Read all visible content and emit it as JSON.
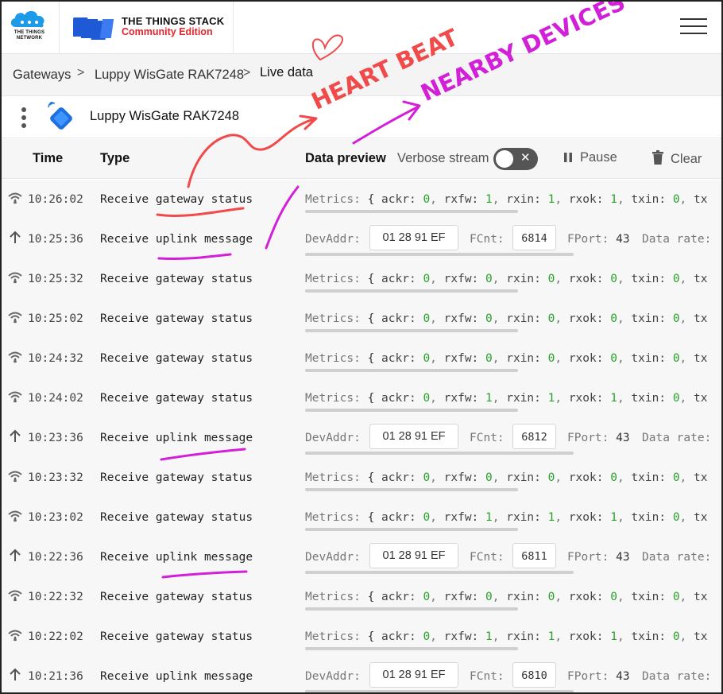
{
  "header": {
    "network_logo_text": "THE THINGS NETWORK",
    "product_title": "THE THINGS STACK",
    "product_subtitle": "Community Edition",
    "colors": {
      "accent_red": "#e3262c",
      "logo_blue": "#1e5ad6",
      "cloud_blue": "#1d9be8"
    },
    "menu_icon": "hamburger-menu-icon"
  },
  "breadcrumb": {
    "items": [
      "Gateways",
      "Luppy WisGate RAK7248",
      "Live data"
    ],
    "separator": ">"
  },
  "gateway": {
    "name": "Luppy WisGate RAK7248",
    "icon": "gateway-icon",
    "menu_icon": "kebab-menu-icon"
  },
  "table": {
    "columns": {
      "time": "Time",
      "type": "Type",
      "preview": "Data preview"
    },
    "verbose_label": "Verbose stream",
    "verbose_enabled": false,
    "pause_label": "Pause",
    "clear_label": "Clear"
  },
  "metrics_labels": {
    "prefix": "Metrics:",
    "ackr": "ackr:",
    "rxfw": "rxfw:",
    "rxin": "rxin:",
    "rxok": "rxok:",
    "txin": "txin:",
    "tx": "tx"
  },
  "uplink_labels": {
    "devaddr": "DevAddr:",
    "fcnt": "FCnt:",
    "fport": "FPort:",
    "datarate": "Data rate:"
  },
  "events": [
    {
      "dir": "gateway-status-icon",
      "time": "10:26:02",
      "type": "Receive gateway status",
      "kind": "status",
      "ackr": "0",
      "rxfw": "1",
      "rxin": "1",
      "rxok": "1",
      "txin": "0"
    },
    {
      "dir": "uplink-arrow-icon",
      "time": "10:25:36",
      "type": "Receive uplink message",
      "kind": "uplink",
      "devaddr": "01 28 91 EF",
      "fcnt": "6814",
      "fport": "43"
    },
    {
      "dir": "gateway-status-icon",
      "time": "10:25:32",
      "type": "Receive gateway status",
      "kind": "status",
      "ackr": "0",
      "rxfw": "0",
      "rxin": "0",
      "rxok": "0",
      "txin": "0"
    },
    {
      "dir": "gateway-status-icon",
      "time": "10:25:02",
      "type": "Receive gateway status",
      "kind": "status",
      "ackr": "0",
      "rxfw": "0",
      "rxin": "0",
      "rxok": "0",
      "txin": "0"
    },
    {
      "dir": "gateway-status-icon",
      "time": "10:24:32",
      "type": "Receive gateway status",
      "kind": "status",
      "ackr": "0",
      "rxfw": "0",
      "rxin": "0",
      "rxok": "0",
      "txin": "0"
    },
    {
      "dir": "gateway-status-icon",
      "time": "10:24:02",
      "type": "Receive gateway status",
      "kind": "status",
      "ackr": "0",
      "rxfw": "1",
      "rxin": "1",
      "rxok": "1",
      "txin": "0"
    },
    {
      "dir": "uplink-arrow-icon",
      "time": "10:23:36",
      "type": "Receive uplink message",
      "kind": "uplink",
      "devaddr": "01 28 91 EF",
      "fcnt": "6812",
      "fport": "43"
    },
    {
      "dir": "gateway-status-icon",
      "time": "10:23:32",
      "type": "Receive gateway status",
      "kind": "status",
      "ackr": "0",
      "rxfw": "0",
      "rxin": "0",
      "rxok": "0",
      "txin": "0"
    },
    {
      "dir": "gateway-status-icon",
      "time": "10:23:02",
      "type": "Receive gateway status",
      "kind": "status",
      "ackr": "0",
      "rxfw": "1",
      "rxin": "1",
      "rxok": "1",
      "txin": "0"
    },
    {
      "dir": "uplink-arrow-icon",
      "time": "10:22:36",
      "type": "Receive uplink message",
      "kind": "uplink",
      "devaddr": "01 28 91 EF",
      "fcnt": "6811",
      "fport": "43"
    },
    {
      "dir": "gateway-status-icon",
      "time": "10:22:32",
      "type": "Receive gateway status",
      "kind": "status",
      "ackr": "0",
      "rxfw": "0",
      "rxin": "0",
      "rxok": "0",
      "txin": "0"
    },
    {
      "dir": "gateway-status-icon",
      "time": "10:22:02",
      "type": "Receive gateway status",
      "kind": "status",
      "ackr": "0",
      "rxfw": "1",
      "rxin": "1",
      "rxok": "1",
      "txin": "0"
    },
    {
      "dir": "uplink-arrow-icon",
      "time": "10:21:36",
      "type": "Receive uplink message",
      "kind": "uplink",
      "devaddr": "01 28 91 EF",
      "fcnt": "6810",
      "fport": "43"
    }
  ],
  "annotations": {
    "heartbeat_text": "HEART BEAT",
    "nearby_text": "NEARBY DEVICES",
    "heartbeat_color": "#f04a4a",
    "nearby_color": "#d21fd8"
  }
}
